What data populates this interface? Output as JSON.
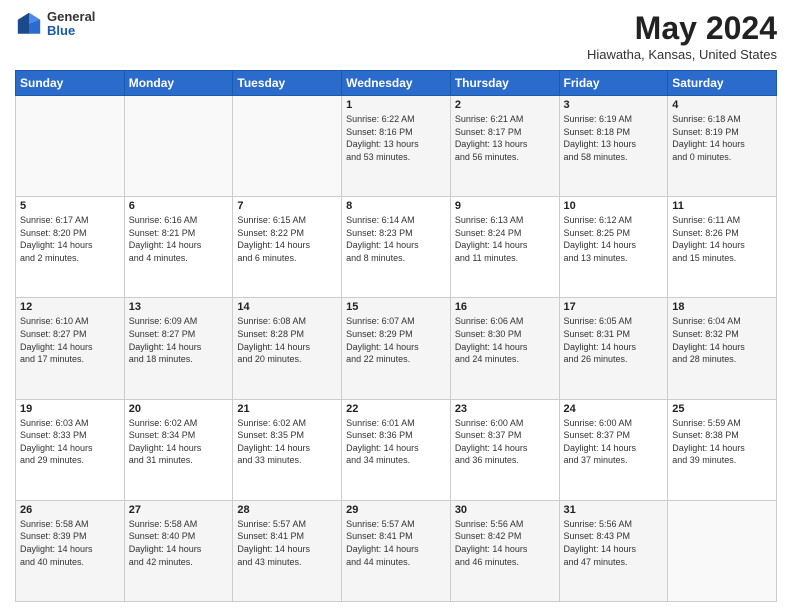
{
  "header": {
    "logo_general": "General",
    "logo_blue": "Blue",
    "month": "May 2024",
    "location": "Hiawatha, Kansas, United States"
  },
  "days_of_week": [
    "Sunday",
    "Monday",
    "Tuesday",
    "Wednesday",
    "Thursday",
    "Friday",
    "Saturday"
  ],
  "weeks": [
    [
      {
        "day": "",
        "info": ""
      },
      {
        "day": "",
        "info": ""
      },
      {
        "day": "",
        "info": ""
      },
      {
        "day": "1",
        "info": "Sunrise: 6:22 AM\nSunset: 8:16 PM\nDaylight: 13 hours\nand 53 minutes."
      },
      {
        "day": "2",
        "info": "Sunrise: 6:21 AM\nSunset: 8:17 PM\nDaylight: 13 hours\nand 56 minutes."
      },
      {
        "day": "3",
        "info": "Sunrise: 6:19 AM\nSunset: 8:18 PM\nDaylight: 13 hours\nand 58 minutes."
      },
      {
        "day": "4",
        "info": "Sunrise: 6:18 AM\nSunset: 8:19 PM\nDaylight: 14 hours\nand 0 minutes."
      }
    ],
    [
      {
        "day": "5",
        "info": "Sunrise: 6:17 AM\nSunset: 8:20 PM\nDaylight: 14 hours\nand 2 minutes."
      },
      {
        "day": "6",
        "info": "Sunrise: 6:16 AM\nSunset: 8:21 PM\nDaylight: 14 hours\nand 4 minutes."
      },
      {
        "day": "7",
        "info": "Sunrise: 6:15 AM\nSunset: 8:22 PM\nDaylight: 14 hours\nand 6 minutes."
      },
      {
        "day": "8",
        "info": "Sunrise: 6:14 AM\nSunset: 8:23 PM\nDaylight: 14 hours\nand 8 minutes."
      },
      {
        "day": "9",
        "info": "Sunrise: 6:13 AM\nSunset: 8:24 PM\nDaylight: 14 hours\nand 11 minutes."
      },
      {
        "day": "10",
        "info": "Sunrise: 6:12 AM\nSunset: 8:25 PM\nDaylight: 14 hours\nand 13 minutes."
      },
      {
        "day": "11",
        "info": "Sunrise: 6:11 AM\nSunset: 8:26 PM\nDaylight: 14 hours\nand 15 minutes."
      }
    ],
    [
      {
        "day": "12",
        "info": "Sunrise: 6:10 AM\nSunset: 8:27 PM\nDaylight: 14 hours\nand 17 minutes."
      },
      {
        "day": "13",
        "info": "Sunrise: 6:09 AM\nSunset: 8:27 PM\nDaylight: 14 hours\nand 18 minutes."
      },
      {
        "day": "14",
        "info": "Sunrise: 6:08 AM\nSunset: 8:28 PM\nDaylight: 14 hours\nand 20 minutes."
      },
      {
        "day": "15",
        "info": "Sunrise: 6:07 AM\nSunset: 8:29 PM\nDaylight: 14 hours\nand 22 minutes."
      },
      {
        "day": "16",
        "info": "Sunrise: 6:06 AM\nSunset: 8:30 PM\nDaylight: 14 hours\nand 24 minutes."
      },
      {
        "day": "17",
        "info": "Sunrise: 6:05 AM\nSunset: 8:31 PM\nDaylight: 14 hours\nand 26 minutes."
      },
      {
        "day": "18",
        "info": "Sunrise: 6:04 AM\nSunset: 8:32 PM\nDaylight: 14 hours\nand 28 minutes."
      }
    ],
    [
      {
        "day": "19",
        "info": "Sunrise: 6:03 AM\nSunset: 8:33 PM\nDaylight: 14 hours\nand 29 minutes."
      },
      {
        "day": "20",
        "info": "Sunrise: 6:02 AM\nSunset: 8:34 PM\nDaylight: 14 hours\nand 31 minutes."
      },
      {
        "day": "21",
        "info": "Sunrise: 6:02 AM\nSunset: 8:35 PM\nDaylight: 14 hours\nand 33 minutes."
      },
      {
        "day": "22",
        "info": "Sunrise: 6:01 AM\nSunset: 8:36 PM\nDaylight: 14 hours\nand 34 minutes."
      },
      {
        "day": "23",
        "info": "Sunrise: 6:00 AM\nSunset: 8:37 PM\nDaylight: 14 hours\nand 36 minutes."
      },
      {
        "day": "24",
        "info": "Sunrise: 6:00 AM\nSunset: 8:37 PM\nDaylight: 14 hours\nand 37 minutes."
      },
      {
        "day": "25",
        "info": "Sunrise: 5:59 AM\nSunset: 8:38 PM\nDaylight: 14 hours\nand 39 minutes."
      }
    ],
    [
      {
        "day": "26",
        "info": "Sunrise: 5:58 AM\nSunset: 8:39 PM\nDaylight: 14 hours\nand 40 minutes."
      },
      {
        "day": "27",
        "info": "Sunrise: 5:58 AM\nSunset: 8:40 PM\nDaylight: 14 hours\nand 42 minutes."
      },
      {
        "day": "28",
        "info": "Sunrise: 5:57 AM\nSunset: 8:41 PM\nDaylight: 14 hours\nand 43 minutes."
      },
      {
        "day": "29",
        "info": "Sunrise: 5:57 AM\nSunset: 8:41 PM\nDaylight: 14 hours\nand 44 minutes."
      },
      {
        "day": "30",
        "info": "Sunrise: 5:56 AM\nSunset: 8:42 PM\nDaylight: 14 hours\nand 46 minutes."
      },
      {
        "day": "31",
        "info": "Sunrise: 5:56 AM\nSunset: 8:43 PM\nDaylight: 14 hours\nand 47 minutes."
      },
      {
        "day": "",
        "info": ""
      }
    ]
  ]
}
